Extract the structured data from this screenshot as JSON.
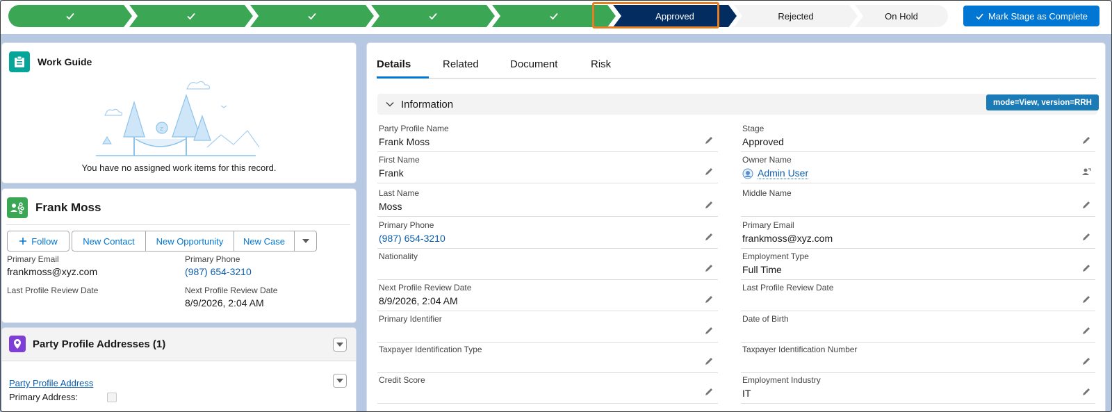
{
  "path": {
    "stages": [
      {
        "label": "",
        "status": "done"
      },
      {
        "label": "",
        "status": "done"
      },
      {
        "label": "",
        "status": "done"
      },
      {
        "label": "",
        "status": "done"
      },
      {
        "label": "",
        "status": "done"
      },
      {
        "label": "Approved",
        "status": "current"
      },
      {
        "label": "Rejected",
        "status": "todo"
      },
      {
        "label": "On Hold",
        "status": "todo"
      }
    ],
    "mark_complete_label": "Mark Stage as Complete"
  },
  "work_guide": {
    "title": "Work Guide",
    "empty_message": "You have no assigned work items for this record."
  },
  "profile_card": {
    "name": "Frank Moss",
    "follow_label": "Follow",
    "new_contact_label": "New Contact",
    "new_opportunity_label": "New Opportunity",
    "new_case_label": "New Case",
    "primary_email_label": "Primary Email",
    "primary_email": "frankmoss@xyz.com",
    "primary_phone_label": "Primary Phone",
    "primary_phone": "(987) 654-3210",
    "last_review_label": "Last Profile Review Date",
    "last_review": "",
    "next_review_label": "Next Profile Review Date",
    "next_review": "8/9/2026, 2:04 AM"
  },
  "addresses": {
    "title": "Party Profile Addresses (1)",
    "item_link": "Party Profile Address",
    "primary_label": "Primary Address:"
  },
  "details": {
    "tabs": [
      "Details",
      "Related",
      "Document",
      "Risk"
    ],
    "section_title": "Information",
    "badge": "mode=View, version=RRH",
    "left_fields": [
      {
        "label": "Party Profile Name",
        "value": "Frank Moss"
      },
      {
        "label": "First Name",
        "value": "Frank"
      },
      {
        "label": "Last Name",
        "value": "Moss"
      },
      {
        "label": "Primary Phone",
        "value": "(987) 654-3210"
      },
      {
        "label": "Nationality",
        "value": ""
      },
      {
        "label": "Next Profile Review Date",
        "value": "8/9/2026, 2:04 AM"
      },
      {
        "label": "Primary Identifier",
        "value": ""
      },
      {
        "label": "Taxpayer Identification Type",
        "value": ""
      },
      {
        "label": "Credit Score",
        "value": ""
      }
    ],
    "right_fields": [
      {
        "label": "Stage",
        "value": "Approved"
      },
      {
        "label": "Owner Name",
        "value": "Admin User"
      },
      {
        "label": "Middle Name",
        "value": ""
      },
      {
        "label": "Primary Email",
        "value": "frankmoss@xyz.com"
      },
      {
        "label": "Employment Type",
        "value": "Full Time"
      },
      {
        "label": "Last Profile Review Date",
        "value": ""
      },
      {
        "label": "Date of Birth",
        "value": ""
      },
      {
        "label": "Taxpayer Identification Number",
        "value": ""
      },
      {
        "label": "Employment Industry",
        "value": "IT"
      }
    ]
  },
  "colors": {
    "stage_done": "#3ba755",
    "stage_current": "#032d60",
    "stage_todo": "#f3f3f3",
    "brand": "#0176d3",
    "current_outline": "#e67e22"
  }
}
